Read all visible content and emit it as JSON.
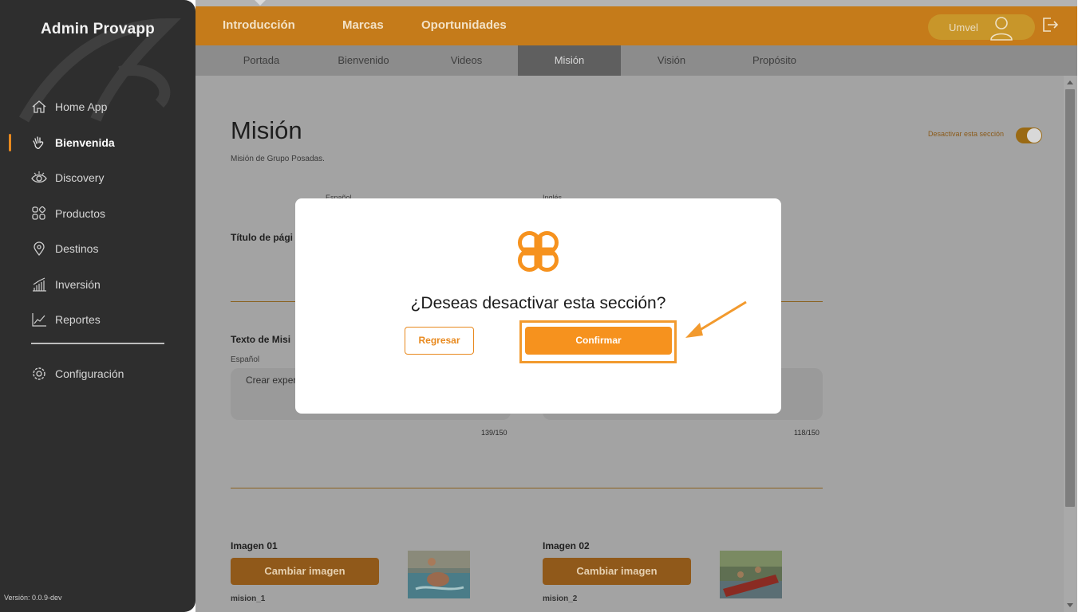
{
  "sidebar": {
    "brand": "Admin Provapp",
    "items": [
      {
        "label": "Home App",
        "icon": "home-icon"
      },
      {
        "label": "Bienvenida",
        "icon": "wave-hand-icon",
        "active": true
      },
      {
        "label": "Discovery",
        "icon": "eye-icon"
      },
      {
        "label": "Productos",
        "icon": "grid-icon"
      },
      {
        "label": "Destinos",
        "icon": "location-pin-icon"
      },
      {
        "label": "Inversión",
        "icon": "bar-chart-icon"
      },
      {
        "label": "Reportes",
        "icon": "line-chart-icon"
      }
    ],
    "config": {
      "label": "Configuración",
      "icon": "gear-icon"
    },
    "version": "Versión: 0.0.9-dev"
  },
  "topbar": {
    "tabs": [
      "Introducción",
      "Marcas",
      "Oportunidades"
    ],
    "user": "Umvel"
  },
  "subtabs": {
    "items": [
      "Portada",
      "Bienvenido",
      "Videos",
      "Misión",
      "Visión",
      "Propósito"
    ],
    "active": "Misión"
  },
  "page": {
    "title": "Misión",
    "subtitle": "Misión de Grupo Posadas.",
    "toggle_label": "Desactivar esta sección",
    "lang_es": "Español",
    "lang_en": "Inglés",
    "page_title_label": "Título de pági",
    "mission_text_label": "Texto de Misi",
    "mission_text_lang": "Español",
    "mission_text_es": "Crear exper vacacionale de nuestros",
    "counter_es": "139/150",
    "counter_en": "118/150",
    "image1": {
      "label": "Imagen 01",
      "button": "Cambiar imagen",
      "file": "mision_1"
    },
    "image2": {
      "label": "Imagen 02",
      "button": "Cambiar imagen",
      "file": "mision_2"
    }
  },
  "modal": {
    "question": "¿Deseas desactivar esta sección?",
    "back_label": "Regresar",
    "confirm_label": "Confirmar"
  },
  "colors": {
    "accent": "#f6921e",
    "topbar": "#c57b1a",
    "sidebar": "#2e2e2e"
  }
}
